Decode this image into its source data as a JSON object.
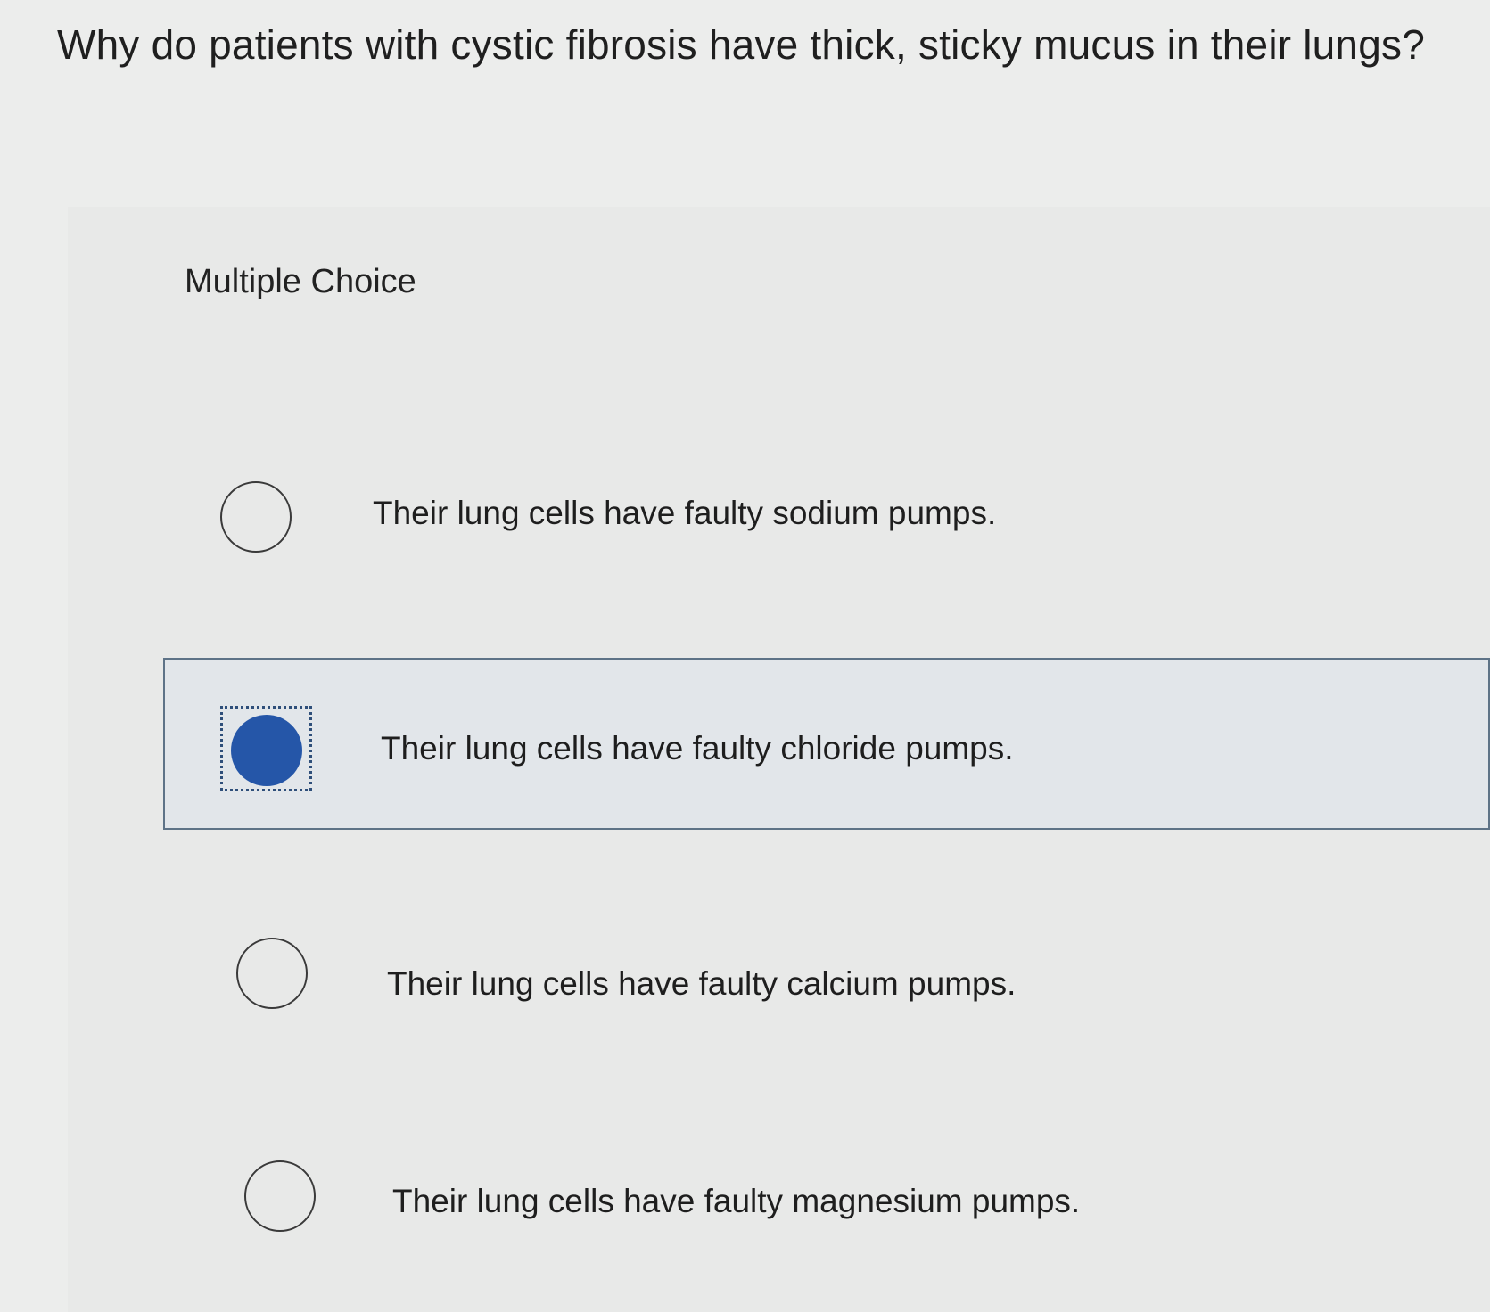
{
  "question": {
    "text": "Why do patients with cystic fibrosis have thick, sticky mucus in their lungs?"
  },
  "section": {
    "heading": "Multiple Choice"
  },
  "options": [
    {
      "label": "Their lung cells have faulty sodium pumps.",
      "selected": false
    },
    {
      "label": "Their lung cells have faulty chloride pumps.",
      "selected": true
    },
    {
      "label": "Their lung cells have faulty calcium pumps.",
      "selected": false
    },
    {
      "label": "Their lung cells have faulty magnesium pumps.",
      "selected": false
    }
  ],
  "colors": {
    "selected_radio": "#2556a8",
    "selected_border": "#5e7387",
    "selected_background": "#e2e6ea"
  }
}
